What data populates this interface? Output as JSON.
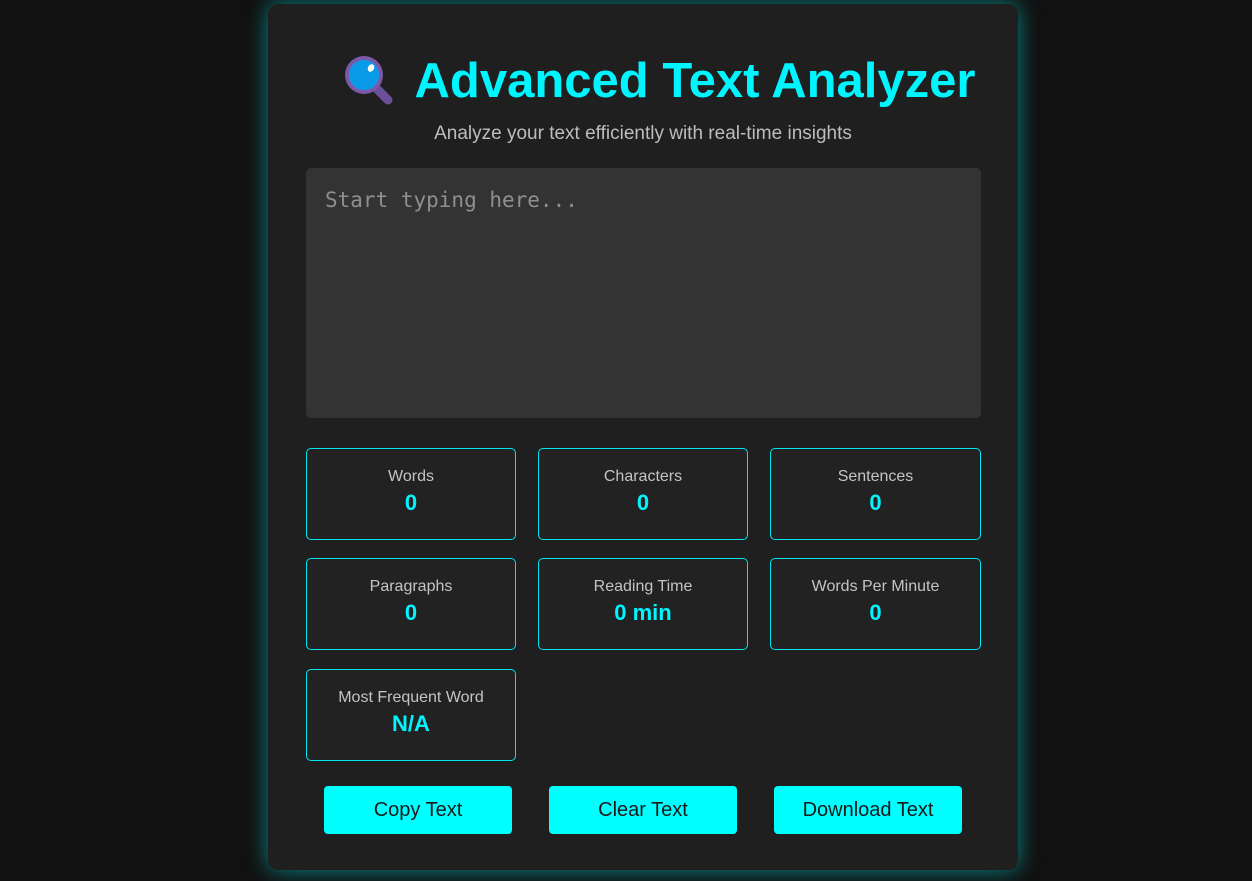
{
  "header": {
    "icon": "magnifying-glass-icon",
    "title": "Advanced Text Analyzer",
    "subtitle": "Analyze your text efficiently with real-time insights"
  },
  "editor": {
    "value": "",
    "placeholder": "Start typing here..."
  },
  "stats": [
    {
      "label": "Words",
      "value": "0"
    },
    {
      "label": "Characters",
      "value": "0"
    },
    {
      "label": "Sentences",
      "value": "0"
    },
    {
      "label": "Paragraphs",
      "value": "0"
    },
    {
      "label": "Reading Time",
      "value": "0 min"
    },
    {
      "label": "Words Per Minute",
      "value": "0"
    },
    {
      "label": "Most Frequent Word",
      "value": "N/A"
    }
  ],
  "buttons": {
    "copy": "Copy Text",
    "clear": "Clear Text",
    "download": "Download Text"
  },
  "colors": {
    "accent": "#00f5ff",
    "background": "#111111",
    "card": "#1f1f1f",
    "editor": "#333333"
  }
}
